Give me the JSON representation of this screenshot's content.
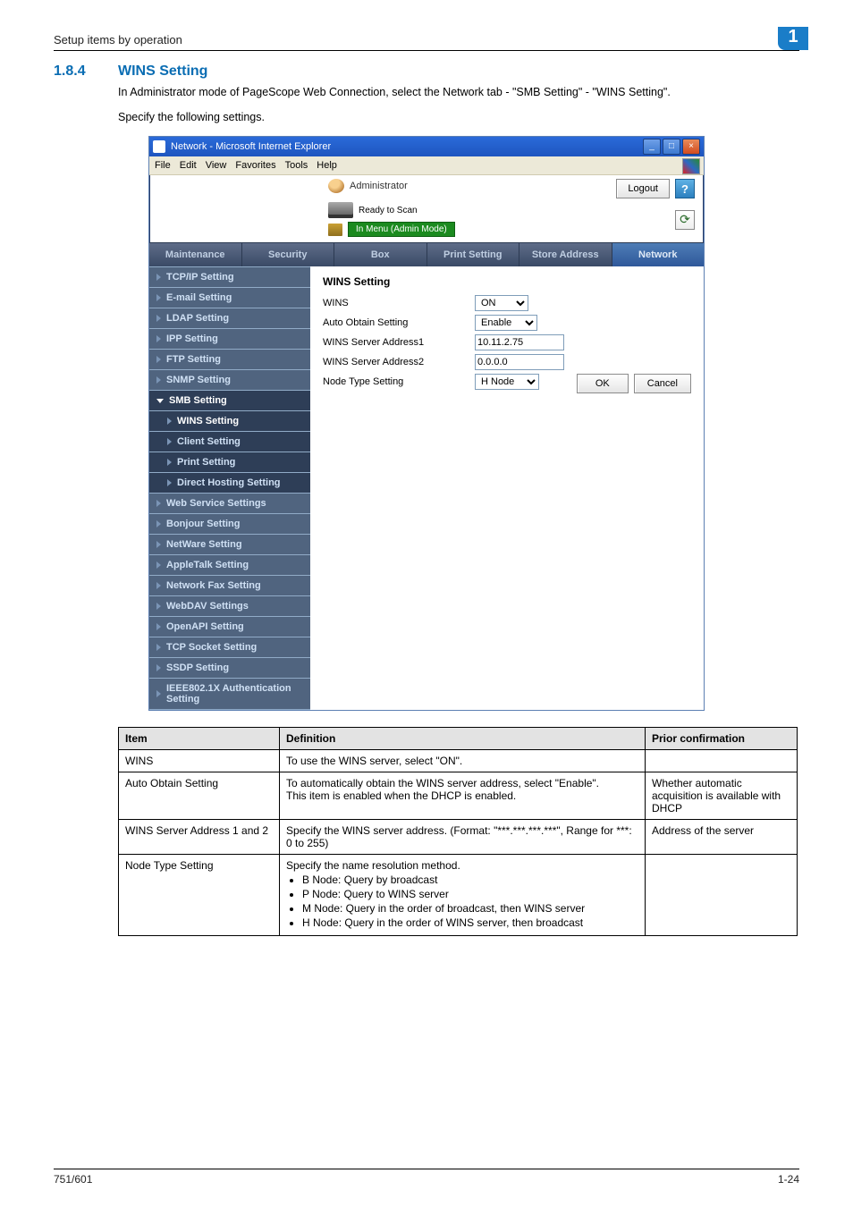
{
  "header": {
    "breadcrumb": "Setup items by operation",
    "chapter": "1"
  },
  "section": {
    "number": "1.8.4",
    "title": "WINS Setting"
  },
  "paragraphs": {
    "p1": "In Administrator mode of PageScope Web Connection, select the Network tab - \"SMB Setting\" - \"WINS Setting\".",
    "p2": "Specify the following settings."
  },
  "window": {
    "title": "Network - Microsoft Internet Explorer",
    "menu": {
      "file": "File",
      "edit": "Edit",
      "view": "View",
      "favorites": "Favorites",
      "tools": "Tools",
      "help": "Help"
    },
    "admin_label": "Administrator",
    "logout": "Logout",
    "status_text": "Ready to Scan",
    "menu_pill": "In Menu (Admin Mode)",
    "tabs": {
      "maintenance": "Maintenance",
      "security": "Security",
      "box": "Box",
      "print": "Print Setting",
      "store": "Store Address",
      "network": "Network"
    },
    "sidebar": {
      "tcpip": "TCP/IP Setting",
      "email": "E-mail Setting",
      "ldap": "LDAP Setting",
      "ipp": "IPP Setting",
      "ftp": "FTP Setting",
      "snmp": "SNMP Setting",
      "smb": "SMB Setting",
      "wins": "WINS Setting",
      "client": "Client Setting",
      "print": "Print Setting",
      "direct": "Direct Hosting Setting",
      "web": "Web Service Settings",
      "bonjour": "Bonjour Setting",
      "netware": "NetWare Setting",
      "appletalk": "AppleTalk Setting",
      "netfax": "Network Fax Setting",
      "webdav": "WebDAV Settings",
      "openapi": "OpenAPI Setting",
      "tcpsocket": "TCP Socket Setting",
      "ssdp": "SSDP Setting",
      "ieee": "IEEE802.1X Authentication Setting"
    },
    "form": {
      "heading": "WINS Setting",
      "rows": {
        "wins": {
          "label": "WINS",
          "value": "ON"
        },
        "auto": {
          "label": "Auto Obtain Setting",
          "value": "Enable"
        },
        "addr1": {
          "label": "WINS Server Address1",
          "value": "10.11.2.75"
        },
        "addr2": {
          "label": "WINS Server Address2",
          "value": "0.0.0.0"
        },
        "node": {
          "label": "Node Type Setting",
          "value": "H Node"
        }
      },
      "ok": "OK",
      "cancel": "Cancel"
    }
  },
  "table": {
    "h1": "Item",
    "h2": "Definition",
    "h3": "Prior confirmation",
    "r1": {
      "c1": "WINS",
      "c2": "To use the WINS server, select \"ON\".",
      "c3": ""
    },
    "r2": {
      "c1": "Auto Obtain Setting",
      "c2a": "To automatically obtain the WINS server address, select \"Enable\".",
      "c2b": "This item is enabled when the DHCP is enabled.",
      "c3": "Whether automatic acquisition is available with DHCP"
    },
    "r3": {
      "c1": "WINS Server Address 1 and 2",
      "c2": "Specify the WINS server address. (Format: \"***.***.***.***\", Range for ***: 0 to 255)",
      "c3": "Address of the server"
    },
    "r4": {
      "c1": "Node Type Setting",
      "c2": "Specify the name resolution method.",
      "li1": "B Node: Query by broadcast",
      "li2": "P Node: Query to WINS server",
      "li3": "M Node: Query in the order of broadcast, then WINS server",
      "li4": "H Node: Query in the order of WINS server, then broadcast",
      "c3": ""
    }
  },
  "footer": {
    "left": "751/601",
    "right": "1-24"
  }
}
